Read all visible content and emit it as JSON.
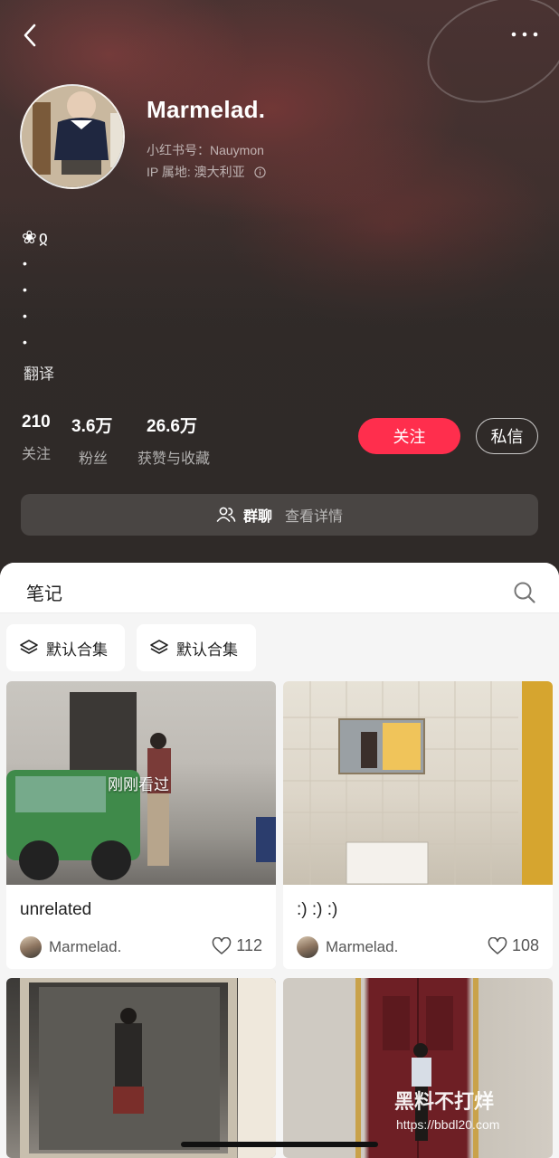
{
  "profile": {
    "nickname": "Marmelad.",
    "id_line": "小红书号：Nauymon",
    "ip_line": "IP 属地: 澳大利亚",
    "bio_emoji": "❀ჲ",
    "bio_dots": [
      "•",
      "•",
      "•",
      "•"
    ],
    "translate_label": "翻译"
  },
  "stats": [
    {
      "value": "210",
      "label": "关注"
    },
    {
      "value": "3.6万",
      "label": "粉丝"
    },
    {
      "value": "26.6万",
      "label": "获赞与收藏"
    }
  ],
  "actions": {
    "follow_label": "关注",
    "message_label": "私信"
  },
  "group_chat": {
    "title": "群聊",
    "detail": "查看详情"
  },
  "tabs": {
    "notes_label": "笔记"
  },
  "albums": [
    {
      "label": "默认合集",
      "icon": "layers-icon"
    },
    {
      "label": "默认合集",
      "icon": "layers-icon"
    }
  ],
  "notes": [
    {
      "title": "unrelated",
      "author": "Marmelad.",
      "likes": "112",
      "badge": "刚刚看过"
    },
    {
      "title": ":) :) :)",
      "author": "Marmelad.",
      "likes": "108",
      "badge": ""
    },
    {
      "title": "",
      "author": "",
      "likes": "",
      "badge": ""
    },
    {
      "title": "",
      "author": "",
      "likes": "",
      "badge": ""
    }
  ],
  "watermark": {
    "text": "黑料不打烊",
    "url": "https://bbdl20.com"
  },
  "colors": {
    "accent": "#ff2e4d",
    "header_bg": "#2f2a28",
    "sheet_bg": "#f5f5f5"
  }
}
